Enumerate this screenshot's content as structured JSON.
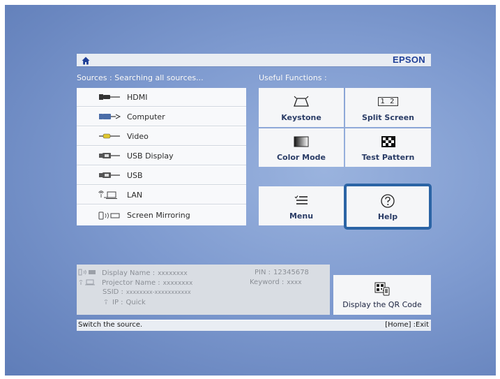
{
  "header": {
    "brand": "EPSON"
  },
  "sources": {
    "label": "Sources : Searching all sources...",
    "items": [
      {
        "label": "HDMI",
        "icon": "hdmi-icon"
      },
      {
        "label": "Computer",
        "icon": "computer-port-icon"
      },
      {
        "label": "Video",
        "icon": "video-port-icon"
      },
      {
        "label": "USB Display",
        "icon": "usb-display-icon"
      },
      {
        "label": "USB",
        "icon": "usb-icon"
      },
      {
        "label": "LAN",
        "icon": "lan-icon"
      },
      {
        "label": "Screen Mirroring",
        "icon": "screen-mirroring-icon"
      }
    ]
  },
  "functions": {
    "label": "Useful Functions :",
    "keystone": "Keystone",
    "split_screen": "Split Screen",
    "color_mode": "Color Mode",
    "test_pattern": "Test Pattern",
    "menu": "Menu",
    "help": "Help",
    "split_screen_icon_text": "1 2"
  },
  "info": {
    "display_name_label": "Display Name :",
    "display_name_value": "xxxxxxxx",
    "projector_name_label": "Projector Name :",
    "projector_name_value": "xxxxxxxx",
    "ssid_label": "SSID :",
    "ssid_value": "xxxxxxxx-xxxxxxxxxxx",
    "ip_label": "IP :",
    "ip_value": "Quick",
    "pin_label": "PIN :",
    "pin_value": "12345678",
    "keyword_label": "Keyword :",
    "keyword_value": "xxxx"
  },
  "qr": {
    "label": "Display the QR Code"
  },
  "status": {
    "hint": "Switch the source.",
    "exit": "[Home] :Exit"
  },
  "colors": {
    "brand": "#1f3f97",
    "highlight_border": "#2b64a5",
    "background": "#7f9bd0"
  }
}
